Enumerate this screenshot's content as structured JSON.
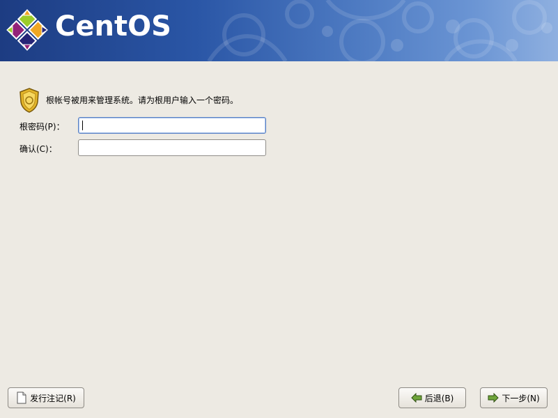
{
  "header": {
    "brand": "CentOS"
  },
  "intro": {
    "text": "根帐号被用来管理系统。请为根用户输入一个密码。"
  },
  "form": {
    "password_label": "根密码(P)：",
    "password_value": "",
    "confirm_label": "确认(C)：",
    "confirm_value": ""
  },
  "buttons": {
    "release_notes": "发行注记(R)",
    "back": "后退(B)",
    "next": "下一步(N)"
  },
  "icons": [
    "centos-logo-icon",
    "security-badge-icon",
    "document-icon",
    "arrow-left-icon",
    "arrow-right-icon"
  ],
  "colors": {
    "header_dark": "#1d3c82",
    "header_light": "#8fb0e0",
    "background": "#edeae3"
  }
}
